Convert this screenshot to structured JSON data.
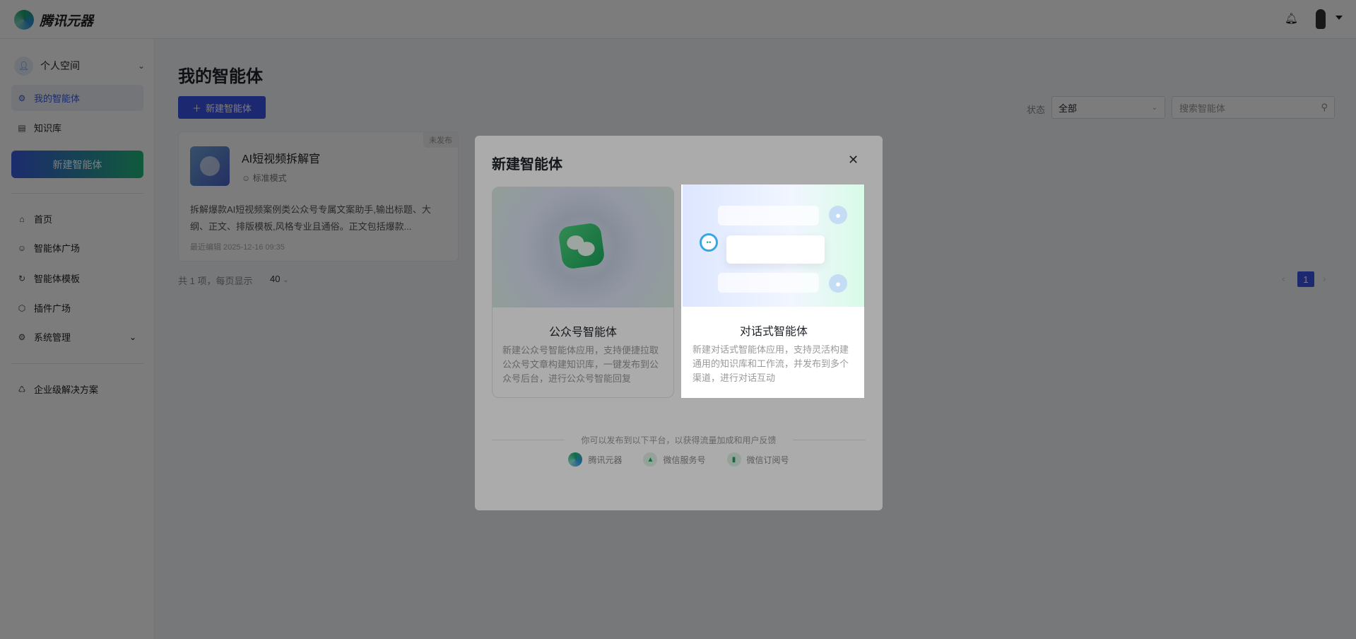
{
  "header": {
    "logo_text": "腾讯元器"
  },
  "sidebar": {
    "space": "个人空间",
    "items": [
      {
        "label": "我的智能体"
      },
      {
        "label": "知识库"
      }
    ],
    "new_button": "新建智能体",
    "nav": [
      {
        "label": "首页"
      },
      {
        "label": "智能体广场"
      },
      {
        "label": "智能体模板"
      },
      {
        "label": "插件广场"
      },
      {
        "label": "系统管理"
      }
    ],
    "enterprise": "企业级解决方案"
  },
  "main": {
    "title": "我的智能体",
    "new_button": "新建智能体",
    "status_label": "状态",
    "status_value": "全部",
    "search_placeholder": "搜索智能体",
    "card": {
      "badge": "未发布",
      "name": "AI短视频拆解官",
      "mode": "标准模式",
      "desc": "拆解爆款AI短视频案例类公众号专属文案助手,输出标题、大纲、正文、排版模板,风格专业且通俗。正文包括爆款...",
      "edited": "最近编辑 2025-12-16 09:35"
    },
    "pager": {
      "total": "共 1 项，每页显示",
      "size": "40",
      "current": "1"
    }
  },
  "modal": {
    "title": "新建智能体",
    "types": [
      {
        "title": "公众号智能体",
        "desc": "新建公众号智能体应用，支持便捷拉取公众号文章构建知识库，一键发布到公众号后台，进行公众号智能回复"
      },
      {
        "title": "对话式智能体",
        "desc": "新建对话式智能体应用，支持灵活构建通用的知识库和工作流，并发布到多个渠道，进行对话互动"
      }
    ],
    "footer_text": "你可以发布到以下平台，以获得流量加成和用户反馈",
    "platforms": [
      {
        "label": "腾讯元器"
      },
      {
        "label": "微信服务号"
      },
      {
        "label": "微信订阅号"
      }
    ]
  }
}
